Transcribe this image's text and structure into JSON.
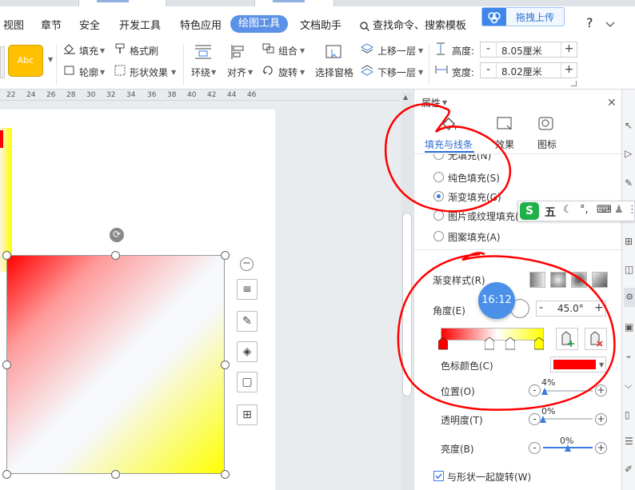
{
  "menu": {
    "items": [
      "视图",
      "章节",
      "安全",
      "开发工具",
      "特色应用",
      "绘图工具",
      "文档助手"
    ],
    "active": "绘图工具",
    "search": "查找命令、搜索模板",
    "help": "?",
    "upload_label": "拖拽上传"
  },
  "ribbon": {
    "style_preview": "Abc",
    "fill": "填充",
    "format_painter": "格式刷",
    "outline": "轮廓",
    "shape_effects": "形状效果",
    "wrap": "环绕",
    "align": "对齐",
    "group": "组合",
    "rotate": "旋转",
    "selection_pane": "选择窗格",
    "bring_forward": "上移一层",
    "send_backward": "下移一层",
    "height_label": "高度:",
    "height_value": "8.05厘米",
    "width_label": "宽度:",
    "width_value": "8.02厘米",
    "minus": "-",
    "plus": "+"
  },
  "ruler": [
    "22",
    "24",
    "26",
    "28",
    "30",
    "32",
    "34",
    "36",
    "38",
    "40",
    "42",
    "44",
    "46"
  ],
  "panel": {
    "header": "属性",
    "tabs": [
      {
        "label": "填充与线条",
        "icon": "fill-bucket-icon",
        "active": true
      },
      {
        "label": "效果",
        "icon": "effect-icon",
        "active": false
      },
      {
        "label": "图标",
        "icon": "chart-icon",
        "active": false
      }
    ],
    "fill_options": [
      {
        "label": "无填充(N)",
        "selected": false
      },
      {
        "label": "纯色填充(S)",
        "selected": false
      },
      {
        "label": "渐变填充(G)",
        "selected": true
      },
      {
        "label": "图片或纹理填充(P)",
        "selected": false
      },
      {
        "label": "图案填充(A)",
        "selected": false
      }
    ],
    "gradient_style_label": "渐变样式(R)",
    "angle_label": "角度(E)",
    "angle_value": "45.0°",
    "stop_color_label": "色标颜色(C)",
    "stop_color": "#ff0000",
    "position_label": "位置(O)",
    "position_value": "4%",
    "transparency_label": "透明度(T)",
    "transparency_value": "0%",
    "brightness_label": "亮度(B)",
    "brightness_value": "0%",
    "rotate_with_shape": "与形状一起旋转(W)",
    "rotate_with_shape_checked": true
  },
  "gradient": {
    "from_color": "#ff0000",
    "to_color": "#ffff00",
    "mid_color": "#f6f8fc",
    "angle": 45
  },
  "ime": {
    "logo": "S",
    "mode": "五"
  },
  "clock": {
    "time": "16:12"
  }
}
